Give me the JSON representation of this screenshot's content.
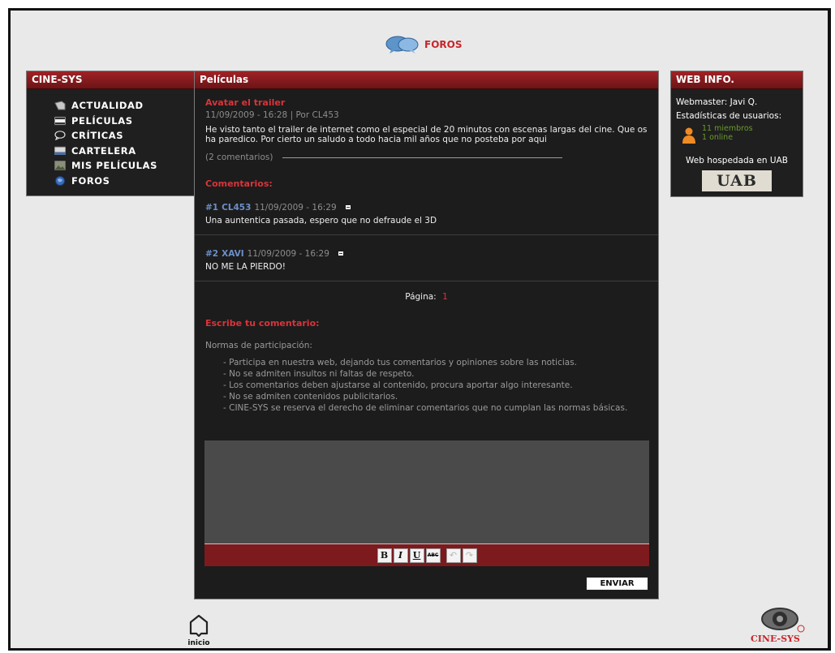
{
  "header": {
    "title": "FOROS"
  },
  "left_panel": {
    "title": "CINE-SYS",
    "items": [
      {
        "label": "ACTUALIDAD",
        "icon": "newspaper-icon"
      },
      {
        "label": "PELÍCULAS",
        "icon": "film-icon"
      },
      {
        "label": "CRÍTICAS",
        "icon": "speech-bubble-icon"
      },
      {
        "label": "CARTELERA",
        "icon": "billboard-icon"
      },
      {
        "label": "MIS PELÍCULAS",
        "icon": "photo-icon"
      },
      {
        "label": "FOROS",
        "icon": "globe-icon"
      }
    ]
  },
  "center_panel": {
    "title": "Películas",
    "article": {
      "headline": "Avatar el trailer",
      "meta": "11/09/2009 - 16:28 | Por CL453",
      "body": "He visto tanto el trailer de internet como el especial de 20 minutos con escenas largas del cine. Que os ha paredico. Por cierto un saludo a todo hacia mil años que no posteba por aqui",
      "comments_link": "(2 comentarios)"
    },
    "comments_title": "Comentarios:",
    "comments": [
      {
        "num": "#1",
        "user": "CL453",
        "date": "11/09/2009 - 16:29",
        "text": "Una auntentica pasada, espero que no defraude el 3D"
      },
      {
        "num": "#2",
        "user": "XAVI",
        "date": "11/09/2009 - 16:29",
        "text": "NO ME LA PIERDO!"
      }
    ],
    "pager": {
      "label": "Página:",
      "current": "1"
    },
    "write_title": "Escribe tu comentario:",
    "rules_title": "Normas de participación:",
    "rules": [
      "- Participa en nuestra web, dejando tus comentarios y opiniones sobre las noticias.",
      "- No se admiten insultos ni faltas de respeto.",
      "- Los comentarios deben ajustarse al contenido, procura aportar algo interesante.",
      "- No se admiten contenidos publicitarios.",
      "- CINE-SYS se reserva el derecho de eliminar comentarios que no cumplan las normas básicas."
    ],
    "textarea_value": "",
    "toolbar": {
      "bold": "B",
      "italic": "I",
      "underline": "U",
      "strike": "ABC",
      "undo": "↶",
      "redo": "↷"
    },
    "send_label": "ENVIAR"
  },
  "right_panel": {
    "title": "WEB INFO.",
    "webmaster": "Webmaster:  Javi Q.",
    "stats_label": "Estadísticas de usuarios:",
    "members": "11 miembros",
    "online": "1 online",
    "hosted": "Web hospedada en UAB",
    "uab_logo": "UAB"
  },
  "footer": {
    "home_label": "inicio",
    "logo_text": "CINE-SYS"
  },
  "colors": {
    "accent_red": "#d8343a",
    "panel_header": "#8a1c20",
    "panel_bg": "#1f1f1f",
    "page_bg": "#e9e9e9"
  }
}
